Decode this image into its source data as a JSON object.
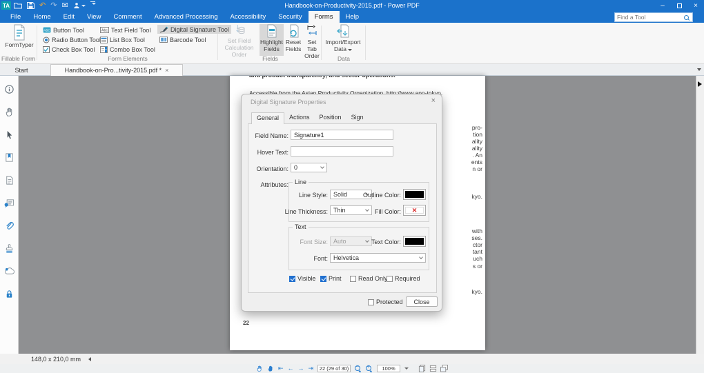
{
  "titlebar": {
    "logo_text": "TA",
    "title": "Handbook-on-Productivity-2015.pdf - Power PDF",
    "minimize_glyph": "–",
    "close_glyph": "×"
  },
  "menu": {
    "items": [
      {
        "label": "File"
      },
      {
        "label": "Home"
      },
      {
        "label": "Edit"
      },
      {
        "label": "View"
      },
      {
        "label": "Comment"
      },
      {
        "label": "Advanced Processing"
      },
      {
        "label": "Accessibility"
      },
      {
        "label": "Security"
      },
      {
        "label": "Forms"
      },
      {
        "label": "Help"
      }
    ],
    "active_item": "Forms",
    "find_tool_placeholder": "Find a Tool"
  },
  "ribbon": {
    "formtyper_label": "FormTyper",
    "fillable_form_group": "Fillable Form",
    "form_elements_group": "Form Elements",
    "tools": [
      "Button Tool",
      "Radio Button Tool",
      "Check Box Tool",
      "Text Field Tool",
      "List Box Tool",
      "Combo Box Tool",
      "Digital Signature Tool",
      "Barcode Tool"
    ],
    "active_tool": "Digital Signature Tool",
    "fields_group": "Fields",
    "set_field_calculation_order": "Set Field Calculation Order",
    "highlight_fields": "Highlight Fields",
    "reset_fields": "Reset Fields",
    "set_tab_order": "Set Tab Order",
    "data_group": "Data",
    "import_export_data": "Import/Export Data"
  },
  "tabbar": {
    "start_tab": "Start",
    "document_tab": "Handbook-on-Pro...tivity-2015.pdf *",
    "close_glyph": "×"
  },
  "document": {
    "top_line": "and product transparency, and sector operations.",
    "citation_line": "Accessible from the Asian Productivity Organization. http://www.apo-tokyo.",
    "right_fragments": [
      "pro-",
      "tion",
      "ality",
      "ality",
      ". An",
      "ents",
      "n or",
      "kyo.",
      "with",
      "ses.",
      "ctor",
      "tant",
      "uch",
      "s or",
      "kyo."
    ],
    "page_number": "22"
  },
  "dialog": {
    "title": "Digital Signature Properties",
    "close_glyph": "×",
    "tabs": [
      {
        "label": "General"
      },
      {
        "label": "Actions"
      },
      {
        "label": "Position"
      },
      {
        "label": "Sign"
      }
    ],
    "active_tab": "General",
    "field_name_label": "Field Name:",
    "field_name_value": "Signature1",
    "hover_text_label": "Hover Text:",
    "hover_text_value": "",
    "orientation_label": "Orientation:",
    "orientation_value": "0",
    "attributes_label": "Attributes:",
    "line_group_label": "Line",
    "line_style_label": "Line Style:",
    "line_style_value": "Solid",
    "outline_color_label": "Outline Color:",
    "line_thickness_label": "Line Thickness:",
    "line_thickness_value": "Thin",
    "fill_color_label": "Fill Color:",
    "fill_color_none_glyph": "✕",
    "text_group_label": "Text",
    "font_size_label": "Font Size:",
    "font_size_value": "Auto",
    "text_color_label": "Text Color:",
    "font_label": "Font:",
    "font_value": "Helvetica",
    "checkboxes": [
      {
        "label": "Visible",
        "checked": true
      },
      {
        "label": "Print",
        "checked": true
      },
      {
        "label": "Read Only",
        "checked": false
      },
      {
        "label": "Required",
        "checked": false
      }
    ],
    "protected_label": "Protected",
    "protected_checked": false,
    "close_button_label": "Close"
  },
  "statusbar": {
    "page_size": "148,0 x 210,0 mm"
  },
  "bottom_toolbar": {
    "first_page_glyph": "⇤",
    "prev_page_glyph": "←",
    "next_page_glyph": "→",
    "last_page_glyph": "⇥",
    "page_display": "22 (29 of 30)",
    "zoom_level": "100%"
  },
  "colors": {
    "titlebar_blue": "#1b72cb",
    "accent_teal": "#35a4c8",
    "accent_blue": "#2b82c9",
    "checkbox_blue": "#2170cf",
    "doc_area_gray": "#8f9092",
    "fill_x_red": "#d93030",
    "active_tool_gray": "#d8d8d8"
  }
}
